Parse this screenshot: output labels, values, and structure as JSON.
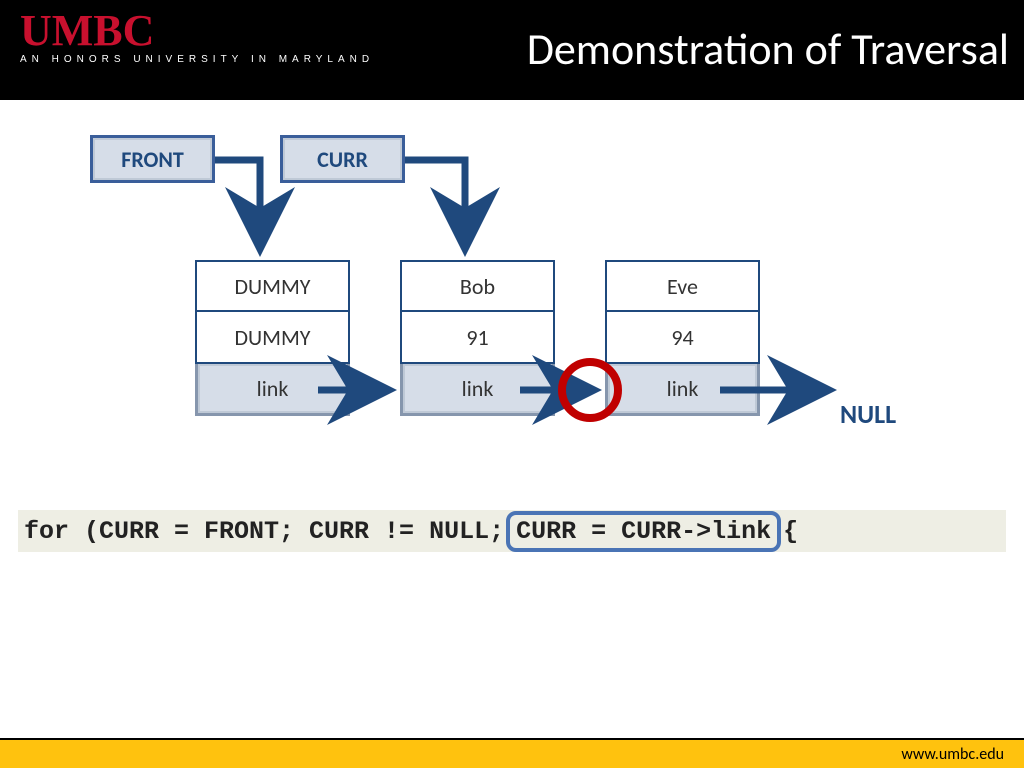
{
  "header": {
    "logo_main": "UMBC",
    "logo_sub": "AN HONORS UNIVERSITY IN MARYLAND",
    "title": "Demonstration of Traversal"
  },
  "pointers": {
    "front": "FRONT",
    "curr": "CURR"
  },
  "nodes": [
    {
      "name": "DUMMY",
      "value": "DUMMY",
      "link": "link"
    },
    {
      "name": "Bob",
      "value": "91",
      "link": "link"
    },
    {
      "name": "Eve",
      "value": "94",
      "link": "link"
    }
  ],
  "null_label": "NULL",
  "code": {
    "part1": "for (CURR = FRONT; CURR != NULL;",
    "highlight": "CURR = CURR->link",
    "part2": "  {"
  },
  "footer": {
    "url": "www.umbc.edu"
  }
}
